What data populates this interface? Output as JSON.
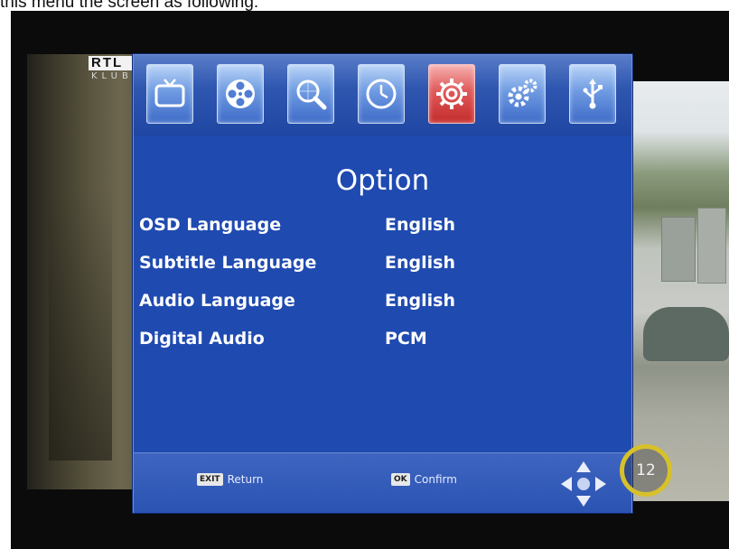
{
  "caption": "this menu the screen as following:",
  "channel_logo": {
    "main": "RTL",
    "sub": "KLUB"
  },
  "menu_tabs": [
    {
      "icon": "tv-icon",
      "active": false
    },
    {
      "icon": "film-reel-icon",
      "active": false
    },
    {
      "icon": "channel-search-icon",
      "active": false
    },
    {
      "icon": "clock-icon",
      "active": false
    },
    {
      "icon": "settings-gear-icon",
      "active": true
    },
    {
      "icon": "system-gears-icon",
      "active": false
    },
    {
      "icon": "usb-icon",
      "active": false
    }
  ],
  "menu": {
    "title": "Option",
    "rows": [
      {
        "label": "OSD Language",
        "value": "English"
      },
      {
        "label": "Subtitle Language",
        "value": "English"
      },
      {
        "label": "Audio Language",
        "value": "English"
      },
      {
        "label": "Digital Audio",
        "value": "PCM"
      }
    ]
  },
  "footer": {
    "return_key": "EXIT",
    "return_label": "Return",
    "confirm_key": "OK",
    "confirm_label": "Confirm",
    "nav_icon": "directional-pad-icon"
  },
  "channel_badge": "12",
  "colors": {
    "panel_blue": "#1f4ab0",
    "active_tab": "#d84040",
    "badge_ring": "#d7c12a"
  }
}
